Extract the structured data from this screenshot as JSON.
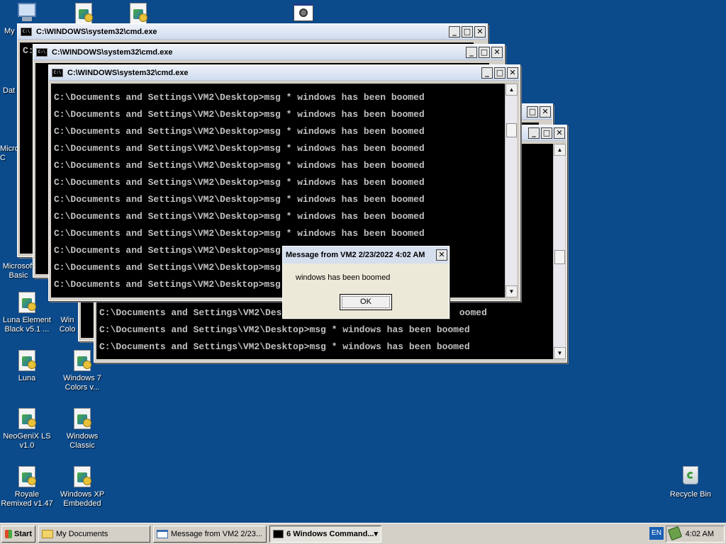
{
  "desktop": {
    "icons": [
      {
        "label": "My",
        "kind": "computer"
      },
      {
        "label": "",
        "kind": "doc"
      },
      {
        "label": "",
        "kind": "doc"
      },
      {
        "label": "",
        "kind": "app"
      },
      {
        "label": "Dat",
        "kind": "doc"
      },
      {
        "label": "Micro C",
        "kind": "doc"
      },
      {
        "label": "Microsoft Basic",
        "kind": "doc"
      },
      {
        "label": "Luna Element Black v5.1 ...",
        "kind": "doc"
      },
      {
        "label": "Win Colo",
        "kind": "doc"
      },
      {
        "label": "Luna",
        "kind": "doc"
      },
      {
        "label": "Windows 7 Colors v...",
        "kind": "doc"
      },
      {
        "label": "NeoGeniX LS v1.0",
        "kind": "doc"
      },
      {
        "label": "Windows Classic",
        "kind": "doc"
      },
      {
        "label": "Royale Remixed v1.47",
        "kind": "doc"
      },
      {
        "label": "Windows XP Embedded",
        "kind": "doc"
      },
      {
        "label": "Recycle Bin",
        "kind": "recycle"
      }
    ]
  },
  "cmd": {
    "title": "C:\\WINDOWS\\system32\\cmd.exe",
    "app_icon_text": "C:\\",
    "line": "C:\\Documents and Settings\\VM2\\Desktop>msg * windows has been boomed",
    "partial_line": "C:\\Documents and Settings\\VM2\\Desktop>msg",
    "tail_line": "oomed",
    "minimize": "_",
    "maximize": "□",
    "close": "✕",
    "scroll_up": "▲",
    "scroll_down": "▼"
  },
  "message": {
    "title": "Message from VM2 2/23/2022 4:02 AM",
    "text": "windows has been boomed",
    "ok": "OK",
    "close": "✕"
  },
  "taskbar": {
    "start": "Start",
    "items": [
      {
        "label": "My Documents"
      },
      {
        "label": "Message from VM2 2/23..."
      },
      {
        "label": "6 Windows Command...",
        "dropdown": "▾"
      }
    ],
    "lang": "EN",
    "clock": "4:02 AM"
  }
}
